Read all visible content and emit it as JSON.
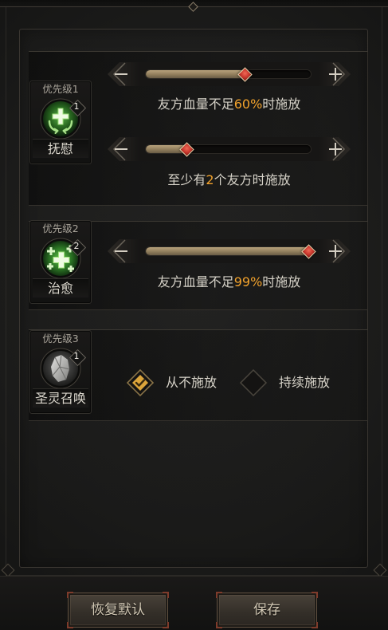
{
  "colors": {
    "value_highlight": "#f2a22c",
    "slider_knob": "#c9372d",
    "slider_fill": "#94815f",
    "check_fill": "#dca53b"
  },
  "icons": {
    "decrease": "minus-icon",
    "increase": "plus-icon",
    "checked": "checkmark-icon"
  },
  "skills": [
    {
      "priority_label": "优先级1",
      "badge": "1",
      "name": "抚慰",
      "icon": "soothe-skill-icon",
      "conditions": [
        {
          "level": 0.6,
          "text_before": "友方血量不足",
          "value": "60%",
          "text_after": "时施放"
        },
        {
          "level": 0.25,
          "text_before": "至少有",
          "value": "2",
          "text_after": "个友方时施放"
        }
      ]
    },
    {
      "priority_label": "优先级2",
      "badge": "2",
      "name": "治愈",
      "icon": "heal-skill-icon",
      "conditions": [
        {
          "level": 0.99,
          "text_before": "友方血量不足",
          "value": "99%",
          "text_after": "时施放"
        }
      ]
    },
    {
      "priority_label": "优先级3",
      "badge": "1",
      "name": "圣灵召唤",
      "icon": "holy-summon-skill-icon",
      "options": [
        {
          "label": "从不施放",
          "checked": true
        },
        {
          "label": "持续施放",
          "checked": false
        }
      ]
    }
  ],
  "footer": {
    "reset_label": "恢复默认",
    "save_label": "保存"
  }
}
